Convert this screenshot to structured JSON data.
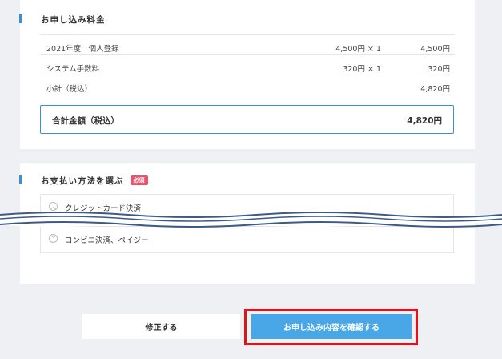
{
  "fee_section": {
    "title": "お申し込み料金",
    "rows": [
      {
        "label": "2021年度　個人登録",
        "qty": "4,500円 × 1",
        "amount": "4,500円"
      },
      {
        "label": "システム手数料",
        "qty": "320円 × 1",
        "amount": "320円"
      },
      {
        "label": "小計（税込）",
        "qty": "",
        "amount": "4,820円"
      }
    ],
    "total_label": "合計金額（税込）",
    "total_amount": "4,820円"
  },
  "payment_section": {
    "title": "お支払い方法を選ぶ",
    "required_badge": "必須",
    "options": [
      {
        "label": "クレジットカード決済",
        "state": "expanded"
      },
      {
        "label": "コンビニ決済、ペイジー",
        "state": "collapsed"
      }
    ]
  },
  "buttons": {
    "edit": "修正する",
    "confirm": "お申し込み内容を確認する"
  },
  "colors": {
    "accent": "#3a8fd4",
    "confirm_button": "#49a7e8",
    "required_badge": "#e8546b",
    "highlight_frame": "#e2121b",
    "wave_line": "#3d5a86"
  },
  "icons": {
    "expanded": "chevron-up-icon",
    "collapsed": "chevron-down-icon"
  }
}
